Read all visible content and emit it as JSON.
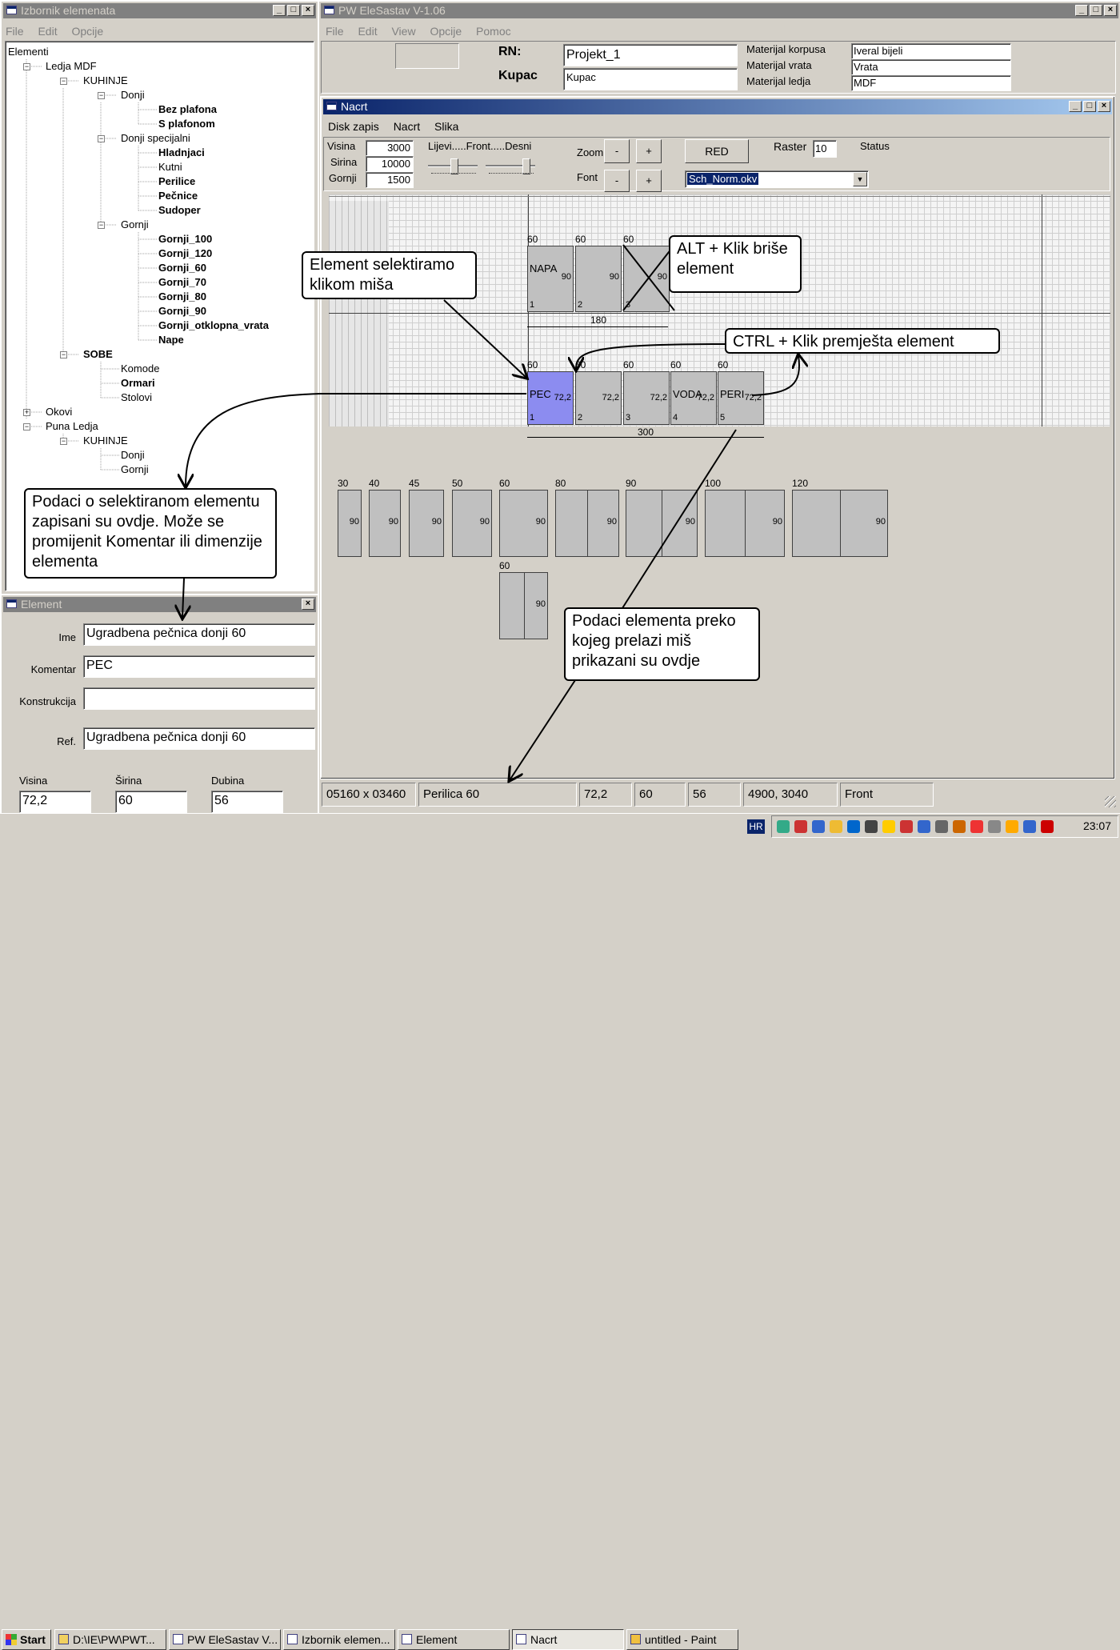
{
  "izbornik": {
    "title": "Izbornik elemenata",
    "menu": [
      "File",
      "Edit",
      "Opcije"
    ],
    "tree": [
      {
        "label": "Elementi",
        "bold": false
      },
      {
        "label": "Ledja MDF",
        "bold": false
      },
      {
        "label": "KUHINJE",
        "bold": false
      },
      {
        "label": "Donji",
        "bold": false
      },
      {
        "label": "Bez plafona",
        "bold": true
      },
      {
        "label": "S plafonom",
        "bold": true
      },
      {
        "label": "Donji specijalni",
        "bold": false
      },
      {
        "label": "Hladnjaci",
        "bold": true
      },
      {
        "label": "Kutni",
        "bold": false
      },
      {
        "label": "Perilice",
        "bold": true
      },
      {
        "label": "Pečnice",
        "bold": true
      },
      {
        "label": "Sudoper",
        "bold": true
      },
      {
        "label": "Gornji",
        "bold": false
      },
      {
        "label": "Gornji_100",
        "bold": true
      },
      {
        "label": "Gornji_120",
        "bold": true
      },
      {
        "label": "Gornji_60",
        "bold": true
      },
      {
        "label": "Gornji_70",
        "bold": true
      },
      {
        "label": "Gornji_80",
        "bold": true
      },
      {
        "label": "Gornji_90",
        "bold": true
      },
      {
        "label": "Gornji_otklopna_vrata",
        "bold": true
      },
      {
        "label": "Nape",
        "bold": true
      },
      {
        "label": "SOBE",
        "bold": false
      },
      {
        "label": "Komode",
        "bold": false
      },
      {
        "label": "Ormari",
        "bold": true
      },
      {
        "label": "Stolovi",
        "bold": false
      },
      {
        "label": "Okovi",
        "bold": false
      },
      {
        "label": "Puna Ledja",
        "bold": false
      },
      {
        "label": "KUHINJE",
        "bold": false
      },
      {
        "label": "Donji",
        "bold": false
      },
      {
        "label": "Gornji",
        "bold": false
      }
    ]
  },
  "element": {
    "title": "Element",
    "ime_label": "Ime",
    "ime_value": "Ugradbena pečnica donji 60",
    "komentar_label": "Komentar",
    "komentar_value": "PEC",
    "konstrukcija_label": "Konstrukcija",
    "konstrukcija_value": "",
    "ref_label": "Ref.",
    "ref_value": "Ugradbena pečnica donji 60",
    "visina_label": "Visina",
    "visina_value": "72,2",
    "sirina_label": "Širina",
    "sirina_value": "60",
    "dubina_label": "Dubina",
    "dubina_value": "56"
  },
  "main": {
    "title": "PW EleSastav V-1.06",
    "menu": [
      "File",
      "Edit",
      "View",
      "Opcije",
      "Pomoc"
    ],
    "rn_label": "RN:",
    "rn_value": "Projekt_1",
    "kupac_label": "Kupac",
    "kupac_value": "Kupac",
    "mat_korpusa_label": "Materijal korpusa",
    "mat_korpusa_value": "Iveral bijeli",
    "mat_vrata_label": "Materijal vrata",
    "mat_vrata_value": "Vrata",
    "mat_ledja_label": "Materijal ledja",
    "mat_ledja_value": "MDF"
  },
  "nacrt": {
    "title": "Nacrt",
    "menu": [
      "Disk zapis",
      "Nacrt",
      "Slika"
    ],
    "visina_label": "Visina",
    "visina_value": "3000",
    "sirina_label": "Sirina",
    "sirina_value": "10000",
    "gornji_label": "Gornji",
    "gornji_value": "1500",
    "slider_label": "Lijevi.....Front.....Desni",
    "zoom_label": "Zoom",
    "font_label": "Font",
    "minus": "-",
    "plus": "+",
    "red_button": "RED",
    "raster_label": "Raster",
    "raster_value": "10",
    "status_label": "Status",
    "combo_value": "Sch_Norm.okv"
  },
  "drawing": {
    "upper_row": [
      {
        "width": "60",
        "name": "NAPA",
        "num": "1",
        "h": "90"
      },
      {
        "width": "60",
        "name": "",
        "num": "2",
        "h": "90"
      },
      {
        "width": "60",
        "name": "",
        "num": "3",
        "h": "90"
      }
    ],
    "upper_total": "180",
    "lower_row": [
      {
        "width": "60",
        "name": "PEC",
        "num": "1",
        "h": "72,2"
      },
      {
        "width": "60",
        "name": "",
        "num": "2",
        "h": "72,2"
      },
      {
        "width": "60",
        "name": "",
        "num": "3",
        "h": "72,2"
      },
      {
        "width": "60",
        "name": "VODA",
        "num": "4",
        "h": "72,2"
      },
      {
        "width": "60",
        "name": "PERI",
        "num": "5",
        "h": "72,2"
      }
    ],
    "lower_total": "300",
    "palette": [
      {
        "width": "30",
        "h": "90"
      },
      {
        "width": "40",
        "h": "90"
      },
      {
        "width": "45",
        "h": "90"
      },
      {
        "width": "50",
        "h": "90"
      },
      {
        "width": "60",
        "h": "90"
      },
      {
        "width": "80",
        "h": "90"
      },
      {
        "width": "90",
        "h": "90"
      },
      {
        "width": "100",
        "h": "90"
      },
      {
        "width": "120",
        "h": "90"
      }
    ],
    "palette2": {
      "width": "60",
      "h": "90"
    }
  },
  "callouts": {
    "select": "Element selektiramo klikom miša",
    "alt": "ALT + Klik briše element",
    "ctrl": "CTRL + Klik premješta element",
    "podaci": "Podaci o selektiranom elementu zapisani su ovdje. Može se promijenit Komentar ili dimenzije elementa",
    "hover": "Podaci elementa preko kojeg prelazi miš prikazani su ovdje"
  },
  "statusbar": [
    "05160 x 03460",
    "Perilica 60",
    "72,2",
    "60",
    "56",
    "4900, 3040",
    "Front"
  ],
  "taskbar": {
    "start": "Start",
    "items": [
      "D:\\IE\\PW\\PWT...",
      "PW EleSastav V...",
      "Izbornik elemen...",
      "Element",
      "Nacrt",
      "untitled - Paint"
    ],
    "lang": "HR",
    "clock": "23:07"
  }
}
